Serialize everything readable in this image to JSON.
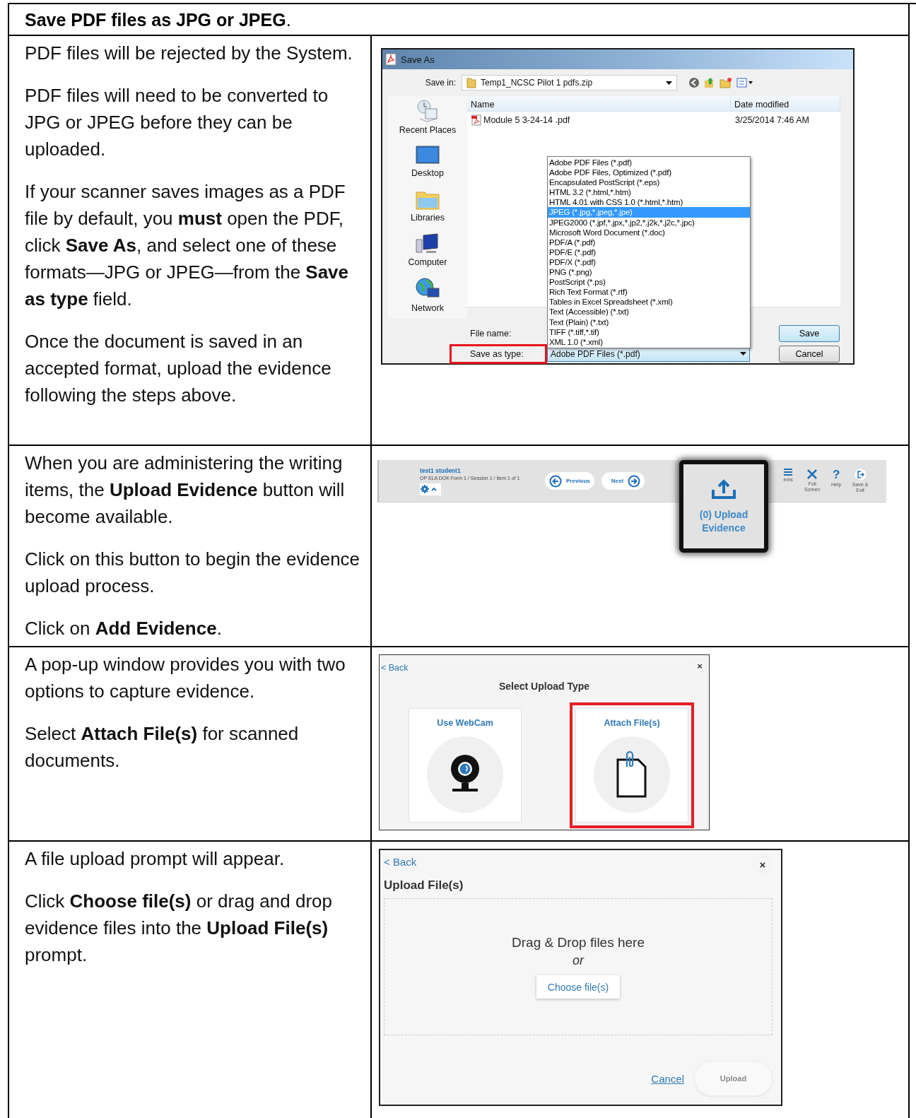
{
  "title": "**Save PDF files as JPG or JPEG**.",
  "rows": [
    {
      "paragraphs": [
        "PDF files will be rejected by the System.",
        "PDF files will need to be converted to JPG or JPEG before they can be uploaded.",
        "If your scanner saves images as a PDF file by default, you **must** open the PDF, click **Save As**, and select one of these formats—JPG or JPEG—from the **Save as type** field.",
        "Once the document is saved in an accepted format, upload the evidence following the steps above."
      ],
      "figure": {
        "kind": "save_as_dialog",
        "title": "Save As",
        "save_in_label": "Save in:",
        "save_in_value": "Temp1_NCSC Pilot 1 pdfs.zip",
        "places": [
          "Recent Places",
          "Desktop",
          "Libraries",
          "Computer",
          "Network"
        ],
        "columns": [
          "Name",
          "Date modified"
        ],
        "files": [
          {
            "name": "Module 5 3-24-14 .pdf",
            "date": "3/25/2014 7:46 AM"
          }
        ],
        "file_name_label": "File name:",
        "save_type_label": "Save as type:",
        "save_type_highlighted": true,
        "save_type_value": "Adobe PDF Files (*.pdf)",
        "options": [
          {
            "label": "Adobe PDF Files (*.pdf)",
            "selected": false
          },
          {
            "label": "Adobe PDF Files, Optimized (*.pdf)",
            "selected": false
          },
          {
            "label": "Encapsulated PostScript (*.eps)",
            "selected": false
          },
          {
            "label": "HTML 3.2 (*.html,*.htm)",
            "selected": false
          },
          {
            "label": "HTML 4.01 with CSS 1.0 (*.html,*.htm)",
            "selected": false
          },
          {
            "label": "JPEG (*.jpg,*.jpeg,*.jpe)",
            "selected": true
          },
          {
            "label": "JPEG2000 (*.jpf,*.jpx,*.jp2,*.j2k,*.j2c,*.jpc)",
            "selected": false
          },
          {
            "label": "Microsoft Word Document (*.doc)",
            "selected": false
          },
          {
            "label": "PDF/A (*.pdf)",
            "selected": false
          },
          {
            "label": "PDF/E (*.pdf)",
            "selected": false
          },
          {
            "label": "PDF/X (*.pdf)",
            "selected": false
          },
          {
            "label": "PNG (*.png)",
            "selected": false
          },
          {
            "label": "PostScript (*.ps)",
            "selected": false
          },
          {
            "label": "Rich Text Format (*.rtf)",
            "selected": false
          },
          {
            "label": "Tables in Excel Spreadsheet (*.xml)",
            "selected": false
          },
          {
            "label": "Text (Accessible) (*.txt)",
            "selected": false
          },
          {
            "label": "Text (Plain) (*.txt)",
            "selected": false
          },
          {
            "label": "TIFF (*.tiff,*.tif)",
            "selected": false
          },
          {
            "label": "XML 1.0 (*.xml)",
            "selected": false
          }
        ],
        "buttons": [
          "Save",
          "Cancel"
        ]
      }
    },
    {
      "paragraphs": [
        "When you are administering the writing items, the **Upload Evidence** button will become available.",
        "Click on this button to begin the evidence upload process.",
        "Click on **Add Evidence**."
      ],
      "figure": {
        "kind": "test_toolbar",
        "student": "test1 student1",
        "breadcrumb": "OP ELA DOK Form 1 / Session 1 / Item 1 of 1",
        "previous": "Previous",
        "next": "Next",
        "callout": "(0) Upload Evidence",
        "tools": [
          {
            "kind": "items",
            "label": "ems"
          },
          {
            "kind": "fullscreen",
            "label": "Full Screen"
          },
          {
            "kind": "help",
            "label": "Help",
            "glyph": "?"
          },
          {
            "kind": "exit",
            "label": "Save & Exit"
          }
        ]
      }
    },
    {
      "paragraphs": [
        "A pop-up window provides you with two options to capture evidence.",
        "Select **Attach File(s)** for scanned documents."
      ],
      "figure": {
        "kind": "upload_type",
        "back": "< Back",
        "close": "×",
        "title": "Select Upload Type",
        "options": [
          {
            "kind": "webcam",
            "label": "Use WebCam",
            "highlighted": false
          },
          {
            "kind": "file",
            "label": "Attach File(s)",
            "highlighted": true
          }
        ]
      }
    },
    {
      "paragraphs": [
        "A file upload prompt will appear.",
        "Click **Choose file(s)** or drag and drop evidence files into the **Upload File(s)** prompt."
      ],
      "figure": {
        "kind": "upload_files",
        "back": "< Back",
        "close": "×",
        "title": "Upload File(s)",
        "drop": "Drag & Drop files here",
        "or": "or",
        "choose": "Choose file(s)",
        "cancel": "Cancel",
        "upload": {
          "label": "Upload",
          "disabled": true
        }
      }
    }
  ]
}
